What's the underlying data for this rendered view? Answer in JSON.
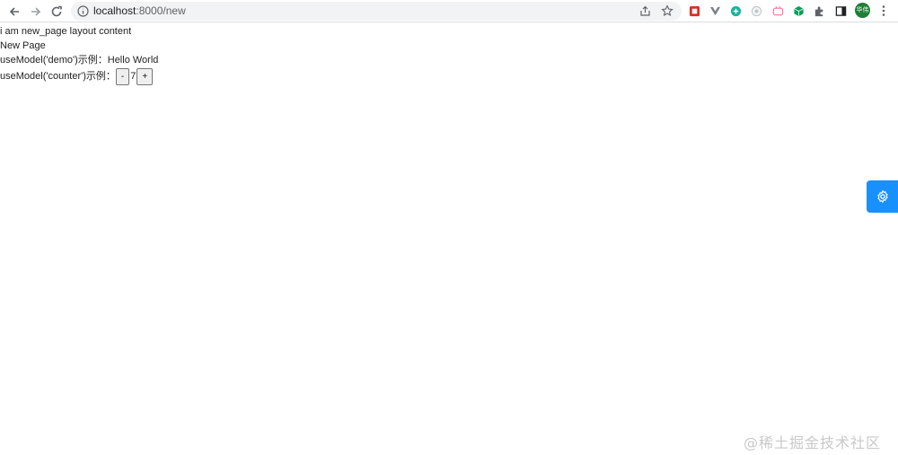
{
  "browser": {
    "url_host": "localhost",
    "url_path": ":8000/new",
    "avatar_text": "华伟",
    "icons": [
      "back-icon",
      "forward-icon",
      "reload-icon",
      "info-icon",
      "share-icon",
      "star-icon",
      "extensions-puzzle-icon",
      "side-panel-icon",
      "menu-kebab-icon"
    ]
  },
  "page": {
    "layout_text": "i am new_page layout content",
    "page_title": "New Page",
    "demo_label": "useModel('demo')示例：",
    "demo_value": "Hello World",
    "counter_label": "useModel('counter')示例：",
    "decrement_label": "-",
    "counter_value": "7",
    "increment_label": "+"
  },
  "settings": {
    "icon": "gear-icon",
    "color": "#1890ff"
  },
  "watermark": "@稀土掘金技术社区"
}
